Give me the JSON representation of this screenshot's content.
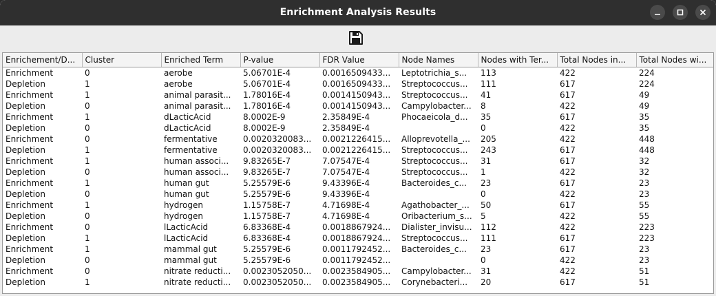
{
  "window": {
    "title": "Enrichment Analysis Results",
    "controls": {
      "minimize": "minimize-icon",
      "maximize": "maximize-icon",
      "close": "close-icon"
    }
  },
  "toolbar": {
    "save_icon": "save-icon"
  },
  "table": {
    "columns": [
      "Enrichement/D...",
      "Cluster",
      "Enriched Term",
      "P-value",
      "FDR Value",
      "Node Names",
      "Nodes with Ter...",
      "Total Nodes in...",
      "Total Nodes wi..."
    ],
    "rows": [
      [
        "Enrichment",
        "0",
        "aerobe",
        "5.06701E-4",
        "0.0016509433...",
        "Leptotrichia_s...",
        "113",
        "422",
        "224"
      ],
      [
        "Depletion",
        "1",
        "aerobe",
        "5.06701E-4",
        "0.0016509433...",
        "Streptococcus...",
        "111",
        "617",
        "224"
      ],
      [
        "Enrichment",
        "1",
        "animal parasit...",
        "1.78016E-4",
        "0.0014150943...",
        "Streptococcus...",
        "41",
        "617",
        "49"
      ],
      [
        "Depletion",
        "0",
        "animal parasit...",
        "1.78016E-4",
        "0.0014150943...",
        "Campylobacter...",
        "8",
        "422",
        "49"
      ],
      [
        "Enrichment",
        "1",
        "dLacticAcid",
        "8.0002E-9",
        "2.35849E-4",
        "Phocaeicola_d...",
        "35",
        "617",
        "35"
      ],
      [
        "Depletion",
        "0",
        "dLacticAcid",
        "8.0002E-9",
        "2.35849E-4",
        "",
        "0",
        "422",
        "35"
      ],
      [
        "Enrichment",
        "0",
        "fermentative",
        "0.0020320083...",
        "0.0021226415...",
        "Alloprevotella_...",
        "205",
        "422",
        "448"
      ],
      [
        "Depletion",
        "1",
        "fermentative",
        "0.0020320083...",
        "0.0021226415...",
        "Streptococcus...",
        "243",
        "617",
        "448"
      ],
      [
        "Enrichment",
        "1",
        "human associ...",
        "9.83265E-7",
        "7.07547E-4",
        "Streptococcus...",
        "31",
        "617",
        "32"
      ],
      [
        "Depletion",
        "0",
        "human associ...",
        "9.83265E-7",
        "7.07547E-4",
        "Streptococcus...",
        "1",
        "422",
        "32"
      ],
      [
        "Enrichment",
        "1",
        "human gut",
        "5.25579E-6",
        "9.43396E-4",
        "Bacteroides_c...",
        "23",
        "617",
        "23"
      ],
      [
        "Depletion",
        "0",
        "human gut",
        "5.25579E-6",
        "9.43396E-4",
        "",
        "0",
        "422",
        "23"
      ],
      [
        "Enrichment",
        "1",
        "hydrogen",
        "1.15758E-7",
        "4.71698E-4",
        "Agathobacter_...",
        "50",
        "617",
        "55"
      ],
      [
        "Depletion",
        "0",
        "hydrogen",
        "1.15758E-7",
        "4.71698E-4",
        "Oribacterium_s...",
        "5",
        "422",
        "55"
      ],
      [
        "Enrichment",
        "0",
        "lLacticAcid",
        "6.83368E-4",
        "0.0018867924...",
        "Dialister_invisu...",
        "112",
        "422",
        "223"
      ],
      [
        "Depletion",
        "1",
        "lLacticAcid",
        "6.83368E-4",
        "0.0018867924...",
        "Streptococcus...",
        "111",
        "617",
        "223"
      ],
      [
        "Enrichment",
        "1",
        "mammal gut",
        "5.25579E-6",
        "0.0011792452...",
        "Bacteroides_c...",
        "23",
        "617",
        "23"
      ],
      [
        "Depletion",
        "0",
        "mammal gut",
        "5.25579E-6",
        "0.0011792452...",
        "",
        "0",
        "422",
        "23"
      ],
      [
        "Enrichment",
        "0",
        "nitrate reducti...",
        "0.0023052050...",
        "0.0023584905...",
        "Campylobacter...",
        "31",
        "422",
        "51"
      ],
      [
        "Depletion",
        "1",
        "nitrate reducti...",
        "0.0023052050...",
        "0.0023584905...",
        "Corynebacteri...",
        "20",
        "617",
        "51"
      ]
    ]
  }
}
